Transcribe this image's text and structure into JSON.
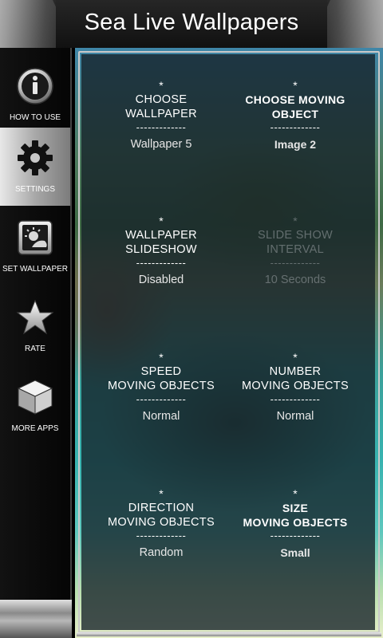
{
  "header": {
    "title": "Sea Live Wallpapers"
  },
  "sidebar": {
    "items": [
      {
        "label": "HOW TO USE",
        "icon": "info-icon",
        "active": false
      },
      {
        "label": "SETTINGS",
        "icon": "gear-icon",
        "active": true
      },
      {
        "label": "SET WALLPAPER",
        "icon": "set-wallpaper-icon",
        "active": false
      },
      {
        "label": "RATE",
        "icon": "star-icon",
        "active": false
      },
      {
        "label": "MORE APPS",
        "icon": "cube-icon",
        "active": false
      }
    ]
  },
  "settings": [
    {
      "star": "*",
      "title_line1": "CHOOSE",
      "title_line2": "WALLPAPER",
      "divider": "-------------",
      "value": "Wallpaper 5",
      "enabled": true
    },
    {
      "star": "*",
      "title_line1": "CHOOSE MOVING",
      "title_line2": "OBJECT",
      "divider": "-------------",
      "value": "Image 2",
      "enabled": true
    },
    {
      "star": "*",
      "title_line1": "WALLPAPER",
      "title_line2": "SLIDESHOW",
      "divider": "-------------",
      "value": "Disabled",
      "enabled": true
    },
    {
      "star": "*",
      "title_line1": "SLIDE SHOW",
      "title_line2": "INTERVAL",
      "divider": "-------------",
      "value": "10 Seconds",
      "enabled": false
    },
    {
      "star": "*",
      "title_line1": "SPEED",
      "title_line2": "MOVING OBJECTS",
      "divider": "-------------",
      "value": "Normal",
      "enabled": true
    },
    {
      "star": "*",
      "title_line1": "NUMBER",
      "title_line2": "MOVING OBJECTS",
      "divider": "-------------",
      "value": "Normal",
      "enabled": true
    },
    {
      "star": "*",
      "title_line1": "DIRECTION",
      "title_line2": "MOVING OBJECTS",
      "divider": "-------------",
      "value": "Random",
      "enabled": true
    },
    {
      "star": "*",
      "title_line1": "SIZE",
      "title_line2": "MOVING OBJECTS",
      "divider": "-------------",
      "value": "Small",
      "enabled": true
    }
  ],
  "colors": {
    "accent": "#ffffff",
    "panel": "#14202a",
    "disabled": "#9aa0a4"
  }
}
